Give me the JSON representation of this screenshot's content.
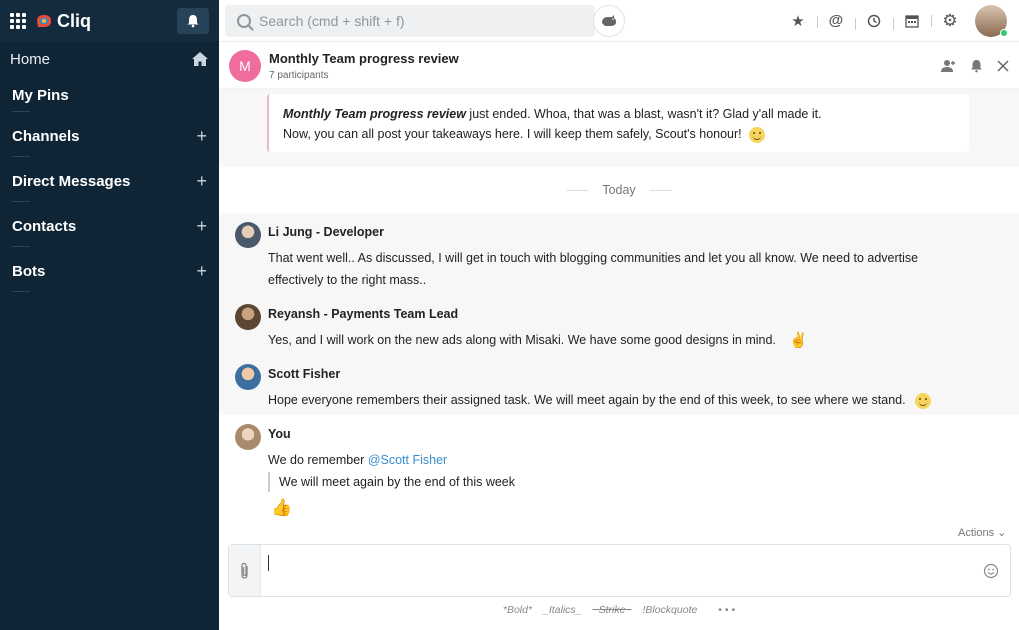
{
  "app": {
    "name": "Cliq"
  },
  "sidebar": {
    "home_label": "Home",
    "items": [
      {
        "label": "My Pins",
        "has_add": false
      },
      {
        "label": "Channels",
        "has_add": true
      },
      {
        "label": "Direct Messages",
        "has_add": true
      },
      {
        "label": "Contacts",
        "has_add": true
      },
      {
        "label": "Bots",
        "has_add": true
      }
    ],
    "add_symbol": "+"
  },
  "search": {
    "placeholder": "Search (cmd + shift + f)"
  },
  "conversation": {
    "avatar_letter": "M",
    "title": "Monthly Team progress review",
    "subtitle": "7 participants"
  },
  "bot_message": {
    "title": "Monthly Team progress review",
    "line1_rest": " just ended. Whoa, that was a blast, wasn't it? Glad y'all made it.",
    "line2": "Now, you can all post your takeaways here. I will keep them safely, Scout's honour!"
  },
  "divider": {
    "label": "Today"
  },
  "messages": [
    {
      "sender": "Li Jung - Developer",
      "text": "That went well.. As discussed, I will get in touch with blogging communities and let you all know. We need to advertise effectively to the right mass.."
    },
    {
      "sender": "Reyansh - Payments Team Lead",
      "text": "Yes, and I will work on the new ads along with Misaki. We have some good designs in mind."
    },
    {
      "sender": "Scott Fisher",
      "text": "Hope everyone remembers their assigned task. We will meet again by the end of this week, to see where we stand."
    },
    {
      "sender": "You",
      "text_prefix": "We do remember ",
      "mention": "@Scott Fisher",
      "quote": "We will meet again by the end of this week"
    }
  ],
  "composer": {
    "actions_label": "Actions ⌄"
  },
  "format_hints": [
    "*Bold*",
    "_Italics_",
    "~Strike~",
    "!Blockquote",
    "• • •"
  ]
}
